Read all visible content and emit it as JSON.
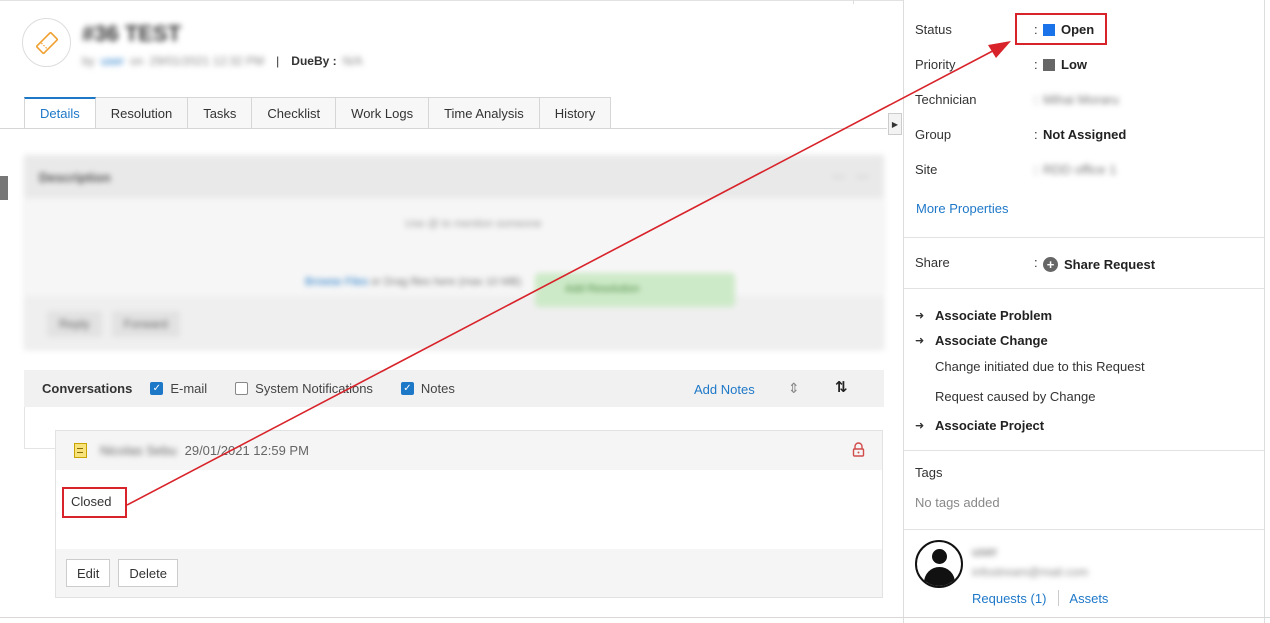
{
  "header": {
    "title": "#36 TEST",
    "by_prefix": "by",
    "by_user": "user",
    "on_prefix": "on",
    "created": "29/01/2021 12:32 PM",
    "separator": "|",
    "dueby_label": "DueBy :",
    "dueby_value": "N/A"
  },
  "tabs": [
    "Details",
    "Resolution",
    "Tasks",
    "Checklist",
    "Work Logs",
    "Time Analysis",
    "History"
  ],
  "editor": {
    "heading": "Description",
    "placeholder": "Use @ to mention someone",
    "attach_text": "Browse Files",
    "attach_suffix": "or Drag files here (max 10 MB)",
    "reply_label": "Reply",
    "forward_label": "Forward",
    "green_label": "Add Resolution"
  },
  "conversations": {
    "label": "Conversations",
    "filters": [
      {
        "label": "E-mail",
        "checked": true
      },
      {
        "label": "System Notifications",
        "checked": false
      },
      {
        "label": "Notes",
        "checked": true
      }
    ],
    "add_notes": "Add Notes",
    "sort_icon": "sort-updown-icon",
    "order_icon": "sort-order-icon"
  },
  "note": {
    "author": "Nicolas Sebu",
    "timestamp": "29/01/2021 12:59 PM",
    "body": "Closed",
    "edit_label": "Edit",
    "delete_label": "Delete"
  },
  "properties": {
    "status": {
      "label": "Status",
      "value": "Open",
      "color": "#1a73e8"
    },
    "priority": {
      "label": "Priority",
      "value": "Low",
      "color": "#666666"
    },
    "technician": {
      "label": "Technician",
      "value": "Mihai Moraru"
    },
    "group": {
      "label": "Group",
      "value": "Not Assigned"
    },
    "site": {
      "label": "Site",
      "value": "RDD office 1"
    },
    "colon": ":",
    "more_properties": "More Properties"
  },
  "share": {
    "label": "Share",
    "action": "Share Request"
  },
  "associations": {
    "problem": "Associate Problem",
    "change": "Associate Change",
    "change_initiated": "Change initiated due to this Request",
    "request_caused": "Request caused by Change",
    "project": "Associate Project"
  },
  "tags": {
    "heading": "Tags",
    "empty": "No tags added"
  },
  "requester": {
    "name": "user",
    "email": "infostream@mail.com",
    "requests_link": "Requests (1)",
    "assets_link": "Assets"
  },
  "colors": {
    "accent": "#1e78c8",
    "annotation": "#d8232a"
  }
}
